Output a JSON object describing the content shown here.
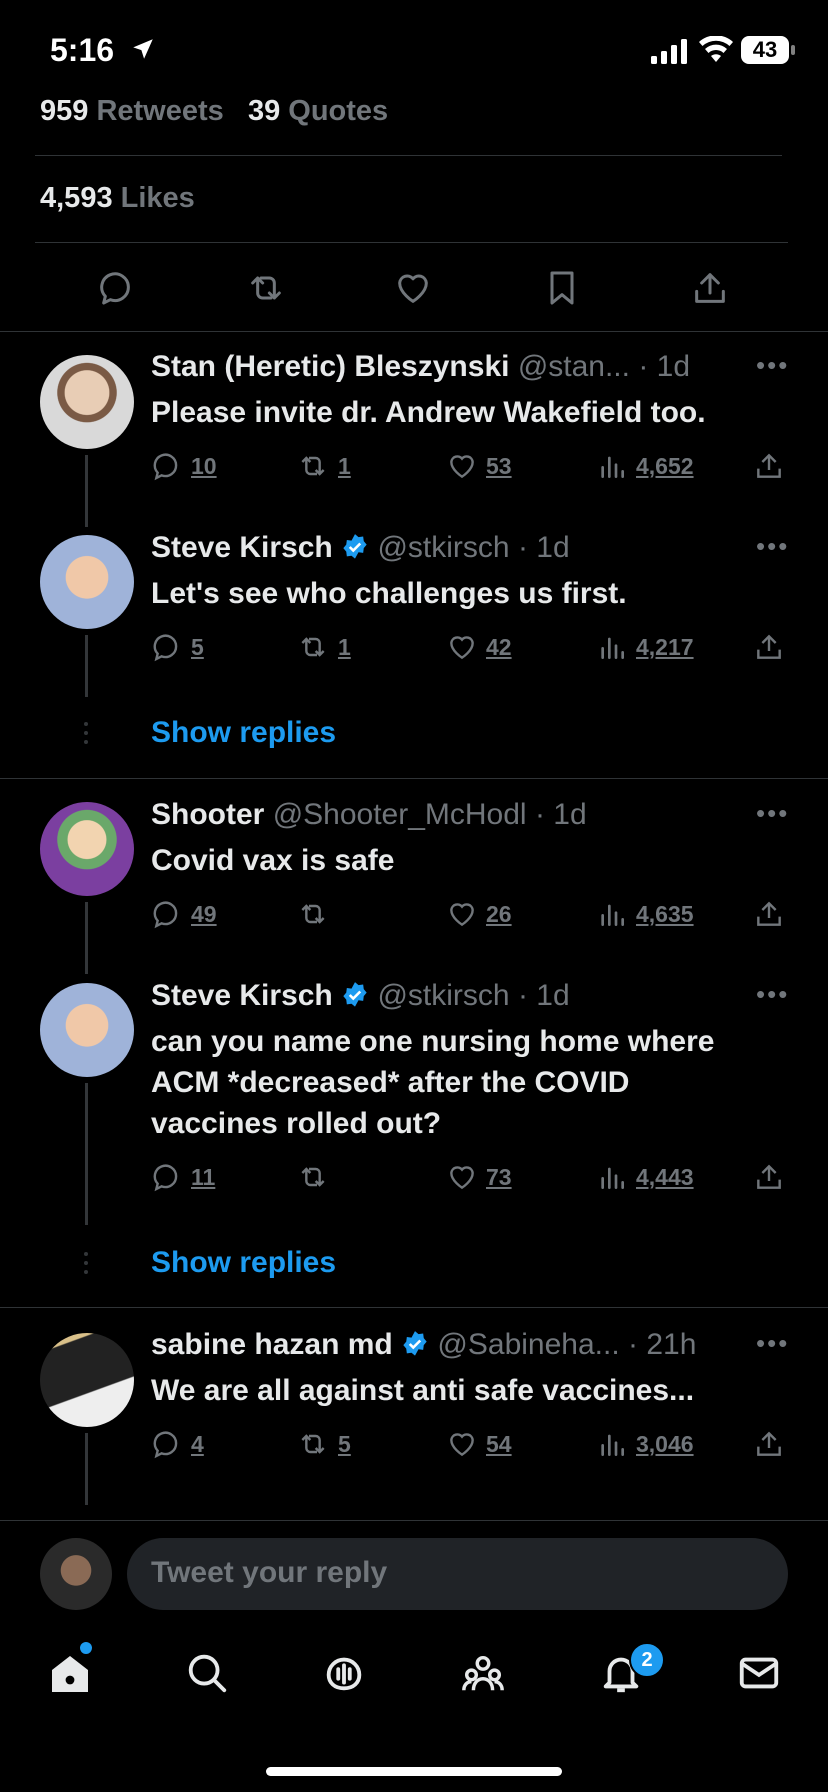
{
  "status_bar": {
    "time": "5:16",
    "battery": "43"
  },
  "stats": {
    "retweets_count": "959",
    "retweets_label": "Retweets",
    "quotes_count": "39",
    "quotes_label": "Quotes",
    "likes_count": "4,593",
    "likes_label": "Likes"
  },
  "tweet_actions": [
    "reply-icon",
    "retweet-icon",
    "like-icon",
    "bookmark-icon",
    "share-icon"
  ],
  "replies": [
    {
      "name": "Stan (Heretic) Bleszynski",
      "handle": "@stan...",
      "time": "· 1d",
      "verified": false,
      "text": "Please invite dr. Andrew Wakefield too.",
      "replies": "10",
      "retweets": "1",
      "likes": "53",
      "views": "4,652"
    },
    {
      "name": "Steve Kirsch",
      "handle": "@stkirsch",
      "time": "· 1d",
      "verified": true,
      "text": "Let's see who challenges us first.",
      "replies": "5",
      "retweets": "1",
      "likes": "42",
      "views": "4,217"
    },
    {
      "name": "Shooter",
      "handle": "@Shooter_McHodl",
      "time": "· 1d",
      "verified": false,
      "text": "Covid vax is safe",
      "replies": "49",
      "retweets": "",
      "likes": "26",
      "views": "4,635"
    },
    {
      "name": "Steve Kirsch",
      "handle": "@stkirsch",
      "time": "· 1d",
      "verified": true,
      "text_lines": [
        "can you name one nursing home where",
        "ACM *decreased* after the COVID",
        "vaccines rolled out?"
      ],
      "replies": "11",
      "retweets": "",
      "likes": "73",
      "views": "4,443"
    },
    {
      "name": "sabine hazan md",
      "handle": "@Sabineha...",
      "time": "· 21h",
      "verified": true,
      "text": "We are all against anti safe vaccines...",
      "replies": "4",
      "retweets": "5",
      "likes": "54",
      "views": "3,046"
    }
  ],
  "show_replies_label": "Show replies",
  "reply_box": {
    "placeholder": "Tweet your reply"
  },
  "bottom_nav": {
    "items": [
      "home-icon",
      "search-icon",
      "spaces-icon",
      "communities-icon",
      "notifications-icon",
      "messages-icon"
    ],
    "notification_badge": "2"
  },
  "colors": {
    "accent": "#1d9bf0",
    "background": "#000000",
    "muted": "#71767b"
  }
}
